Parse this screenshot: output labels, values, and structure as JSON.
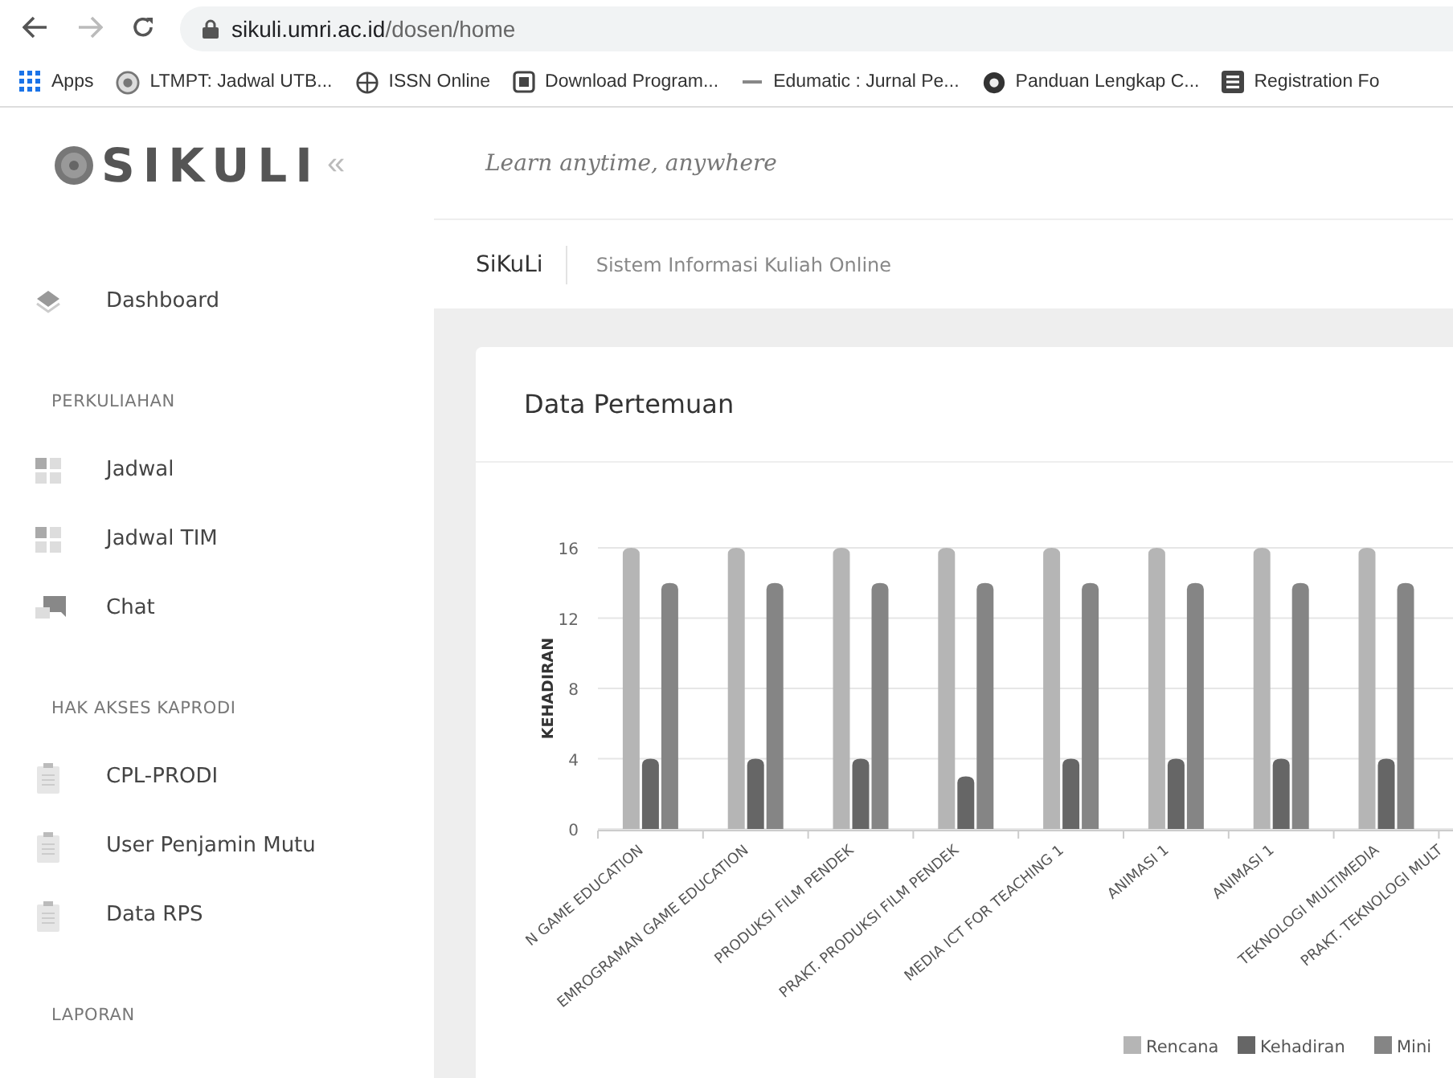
{
  "browser": {
    "url_host": "sikuli.umri.ac.id",
    "url_path": "/dosen/home"
  },
  "bookmarks": [
    {
      "label": "Apps"
    },
    {
      "label": "LTMPT: Jadwal UTB..."
    },
    {
      "label": "ISSN Online"
    },
    {
      "label": "Download Program..."
    },
    {
      "label": "Edumatic : Jurnal Pe..."
    },
    {
      "label": "Panduan Lengkap C..."
    },
    {
      "label": "Registration Fo"
    }
  ],
  "sidebar": {
    "logo": "SIKULI",
    "collapse": "«",
    "items": [
      {
        "kind": "item",
        "label": "Dashboard"
      },
      {
        "kind": "heading",
        "label": "PERKULIAHAN"
      },
      {
        "kind": "item",
        "label": "Jadwal"
      },
      {
        "kind": "item",
        "label": "Jadwal TIM"
      },
      {
        "kind": "item",
        "label": "Chat"
      },
      {
        "kind": "heading",
        "label": "HAK AKSES KAPRODI"
      },
      {
        "kind": "item",
        "label": "CPL-PRODI"
      },
      {
        "kind": "item",
        "label": "User Penjamin Mutu"
      },
      {
        "kind": "item",
        "label": "Data RPS"
      },
      {
        "kind": "heading",
        "label": "LAPORAN"
      }
    ]
  },
  "header": {
    "tagline": "Learn anytime, anywhere"
  },
  "subheader": {
    "app_name": "SiKuLi",
    "subtitle": "Sistem Informasi Kuliah Online"
  },
  "card": {
    "title": "Data Pertemuan",
    "chart_data": {
      "type": "bar",
      "ylabel": "KEHADIRAN",
      "categories": [
        "N GAME EDUCATION",
        "EMROGRAMAN GAME EDUCATION",
        "PRODUKSI FILM PENDEK",
        "PRAKT. PRODUKSI FILM PENDEK",
        "MEDIA ICT FOR TEACHING 1",
        "ANIMASI 1",
        "ANIMASI 1",
        "TEKNOLOGI MULTIMEDIA",
        "PRAKT. TEKNOLOGI MULT"
      ],
      "series": [
        {
          "name": "Rencana",
          "color": "#b5b5b5",
          "values": [
            16,
            16,
            16,
            16,
            16,
            16,
            16,
            16,
            null
          ]
        },
        {
          "name": "Kehadiran",
          "color": "#666666",
          "values": [
            4,
            4,
            4,
            3,
            4,
            4,
            4,
            4,
            null
          ]
        },
        {
          "name": "Mini",
          "color": "#858585",
          "values": [
            14,
            14,
            14,
            14,
            14,
            14,
            14,
            14,
            null
          ]
        }
      ],
      "ylim": [
        0,
        16
      ],
      "yticks": [
        0,
        4,
        8,
        12,
        16
      ],
      "grid": true,
      "legend": true
    }
  }
}
